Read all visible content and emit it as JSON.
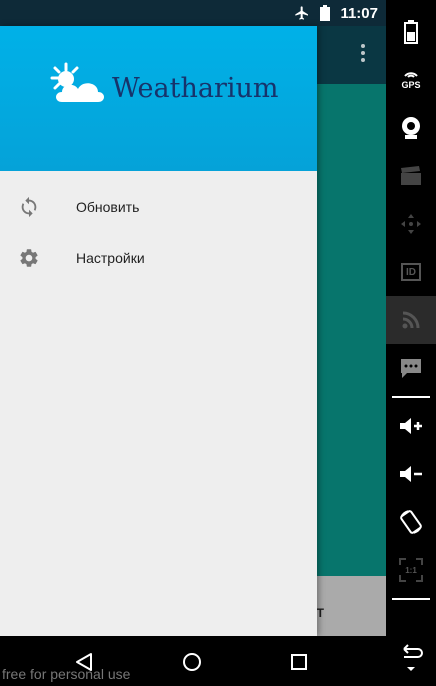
{
  "status_bar": {
    "time": "11:07",
    "icons": [
      "airplane-icon",
      "battery-icon"
    ]
  },
  "drawer": {
    "header": {
      "logo_text": "Weatharium",
      "logo_icon": "sun-cloud-icon",
      "background": "#05a2d8"
    },
    "items": [
      {
        "label": "Обновить",
        "icon": "refresh-icon"
      },
      {
        "label": "Настройки",
        "icon": "settings-gear-icon"
      }
    ]
  },
  "app": {
    "bottom_tab_label": "AST",
    "content_color": "#087f76"
  },
  "navigation": {
    "buttons": [
      "back-icon",
      "home-icon",
      "recents-icon"
    ]
  },
  "watermark": "free for personal use",
  "side_panel": {
    "buttons": [
      "battery-icon",
      "gps-icon",
      "camera-icon",
      "clapperboard-icon",
      "dpad-icon",
      "id-icon",
      "rss-icon",
      "sms-icon",
      "volume-up-icon",
      "volume-down-icon",
      "rotate-icon",
      "scale-icon",
      "back-arrow-icon"
    ],
    "gps_label": "GPS",
    "id_label": "ID",
    "scale_label": "1:1"
  }
}
